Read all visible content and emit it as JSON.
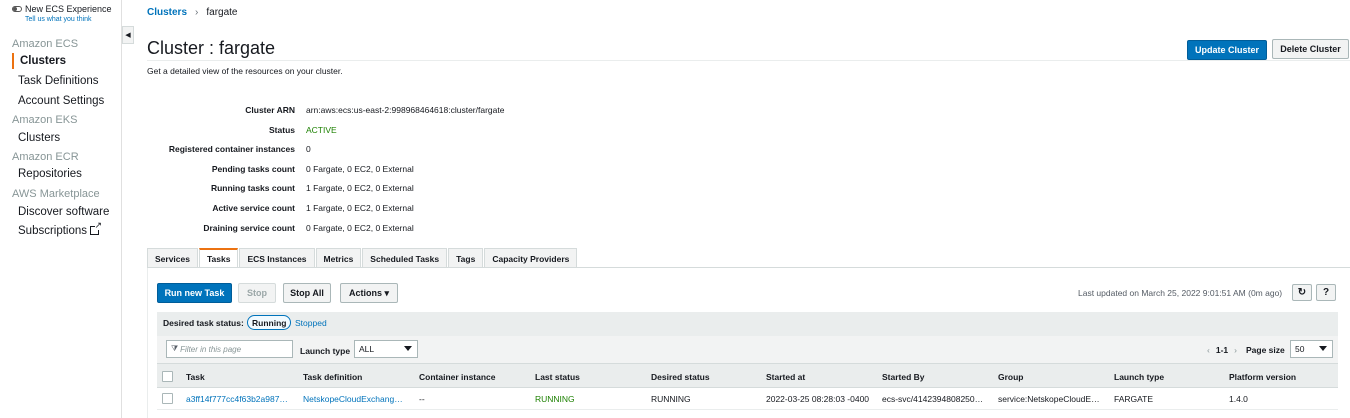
{
  "sidebar": {
    "new_experience": "New ECS Experience",
    "tell_us": "Tell us what you think",
    "sections": [
      {
        "title": "Amazon ECS",
        "items": [
          "Clusters",
          "Task Definitions",
          "Account Settings"
        ]
      },
      {
        "title": "Amazon EKS",
        "items": [
          "Clusters"
        ]
      },
      {
        "title": "Amazon ECR",
        "items": [
          "Repositories"
        ]
      },
      {
        "title": "AWS Marketplace",
        "items": [
          "Discover software",
          "Subscriptions"
        ]
      }
    ],
    "active_item": "Clusters"
  },
  "breadcrumb": {
    "root": "Clusters",
    "sep": "›",
    "current": "fargate"
  },
  "header": {
    "title": "Cluster : fargate",
    "subtitle": "Get a detailed view of the resources on your cluster.",
    "update_button": "Update Cluster",
    "delete_button": "Delete Cluster"
  },
  "details": [
    {
      "label": "Cluster ARN",
      "value": "arn:aws:ecs:us-east-2:998968464618:cluster/fargate"
    },
    {
      "label": "Status",
      "value": "ACTIVE"
    },
    {
      "label": "Registered container instances",
      "value": "0"
    },
    {
      "label": "Pending tasks count",
      "value": "0 Fargate, 0 EC2, 0 External"
    },
    {
      "label": "Running tasks count",
      "value": "1 Fargate, 0 EC2, 0 External"
    },
    {
      "label": "Active service count",
      "value": "1 Fargate, 0 EC2, 0 External"
    },
    {
      "label": "Draining service count",
      "value": "0 Fargate, 0 EC2, 0 External"
    }
  ],
  "tabs": [
    "Services",
    "Tasks",
    "ECS Instances",
    "Metrics",
    "Scheduled Tasks",
    "Tags",
    "Capacity Providers"
  ],
  "active_tab": "Tasks",
  "toolbar": {
    "run_new_task": "Run new Task",
    "stop": "Stop",
    "stop_all": "Stop All",
    "actions": "Actions ▾",
    "last_updated": "Last updated on March 25, 2022 9:01:51 AM (0m ago)",
    "refresh_icon": "↻",
    "help_icon": "?"
  },
  "desired_status": {
    "label": "Desired task status:",
    "running": "Running",
    "stopped": "Stopped"
  },
  "filter": {
    "placeholder": "Filter in this page",
    "launch_type_label": "Launch type",
    "launch_type_value": "ALL",
    "pager_range": "1-1",
    "pager_prev": "‹",
    "pager_next": "›",
    "page_size_label": "Page size",
    "page_size_value": "50"
  },
  "table": {
    "columns": [
      "Task",
      "Task definition",
      "Container instance",
      "Last status",
      "Desired status",
      "Started at",
      "Started By",
      "Group",
      "Launch type",
      "Platform version"
    ],
    "rows": [
      [
        "a3ff14f777cc4f63b2a987…",
        "NetskopeCloudExchang…",
        "--",
        "RUNNING",
        "RUNNING",
        "2022-03-25 08:28:03 -0400",
        "ecs-svc/4142394808250…",
        "service:NetskopeCloudE…",
        "FARGATE",
        "1.4.0"
      ]
    ]
  },
  "colors": {
    "primary": "#0073bb",
    "accent_orange": "#ec7211",
    "status_green": "#1d8102"
  }
}
